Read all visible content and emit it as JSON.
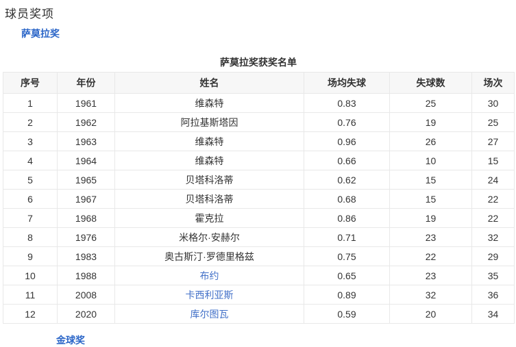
{
  "page": {
    "title": "球员奖项"
  },
  "section": {
    "award_link_label": "萨莫拉奖"
  },
  "table": {
    "caption": "萨莫拉奖获奖名单",
    "columns": [
      "序号",
      "年份",
      "姓名",
      "场均失球",
      "失球数",
      "场次"
    ],
    "rows": [
      {
        "index": "1",
        "year": "1961",
        "name": "维森特",
        "name_is_link": false,
        "avg": "0.83",
        "conceded": "25",
        "matches": "30"
      },
      {
        "index": "2",
        "year": "1962",
        "name": "阿拉基斯塔因",
        "name_is_link": false,
        "avg": "0.76",
        "conceded": "19",
        "matches": "25"
      },
      {
        "index": "3",
        "year": "1963",
        "name": "维森特",
        "name_is_link": false,
        "avg": "0.96",
        "conceded": "26",
        "matches": "27"
      },
      {
        "index": "4",
        "year": "1964",
        "name": "维森特",
        "name_is_link": false,
        "avg": "0.66",
        "conceded": "10",
        "matches": "15"
      },
      {
        "index": "5",
        "year": "1965",
        "name": "贝塔科洛蒂",
        "name_is_link": false,
        "avg": "0.62",
        "conceded": "15",
        "matches": "24"
      },
      {
        "index": "6",
        "year": "1967",
        "name": "贝塔科洛蒂",
        "name_is_link": false,
        "avg": "0.68",
        "conceded": "15",
        "matches": "22"
      },
      {
        "index": "7",
        "year": "1968",
        "name": "霍克拉",
        "name_is_link": false,
        "avg": "0.86",
        "conceded": "19",
        "matches": "22"
      },
      {
        "index": "8",
        "year": "1976",
        "name": "米格尔·安赫尔",
        "name_is_link": false,
        "avg": "0.71",
        "conceded": "23",
        "matches": "32"
      },
      {
        "index": "9",
        "year": "1983",
        "name": "奥古斯汀·罗德里格兹",
        "name_is_link": false,
        "avg": "0.75",
        "conceded": "22",
        "matches": "29"
      },
      {
        "index": "10",
        "year": "1988",
        "name": "布约",
        "name_is_link": true,
        "avg": "0.65",
        "conceded": "23",
        "matches": "35"
      },
      {
        "index": "11",
        "year": "2008",
        "name": "卡西利亚斯",
        "name_is_link": true,
        "avg": "0.89",
        "conceded": "32",
        "matches": "36"
      },
      {
        "index": "12",
        "year": "2020",
        "name": "库尔图瓦",
        "name_is_link": true,
        "avg": "0.59",
        "conceded": "20",
        "matches": "34"
      }
    ]
  },
  "footer": {
    "partial_link_label": "金球奖"
  },
  "colors": {
    "section_link_blue": "#2b66c8",
    "player_link_blue": "#4270c8",
    "header_background": "#f7f7f7",
    "table_border": "#e8e8e8",
    "body_text": "#333333"
  }
}
